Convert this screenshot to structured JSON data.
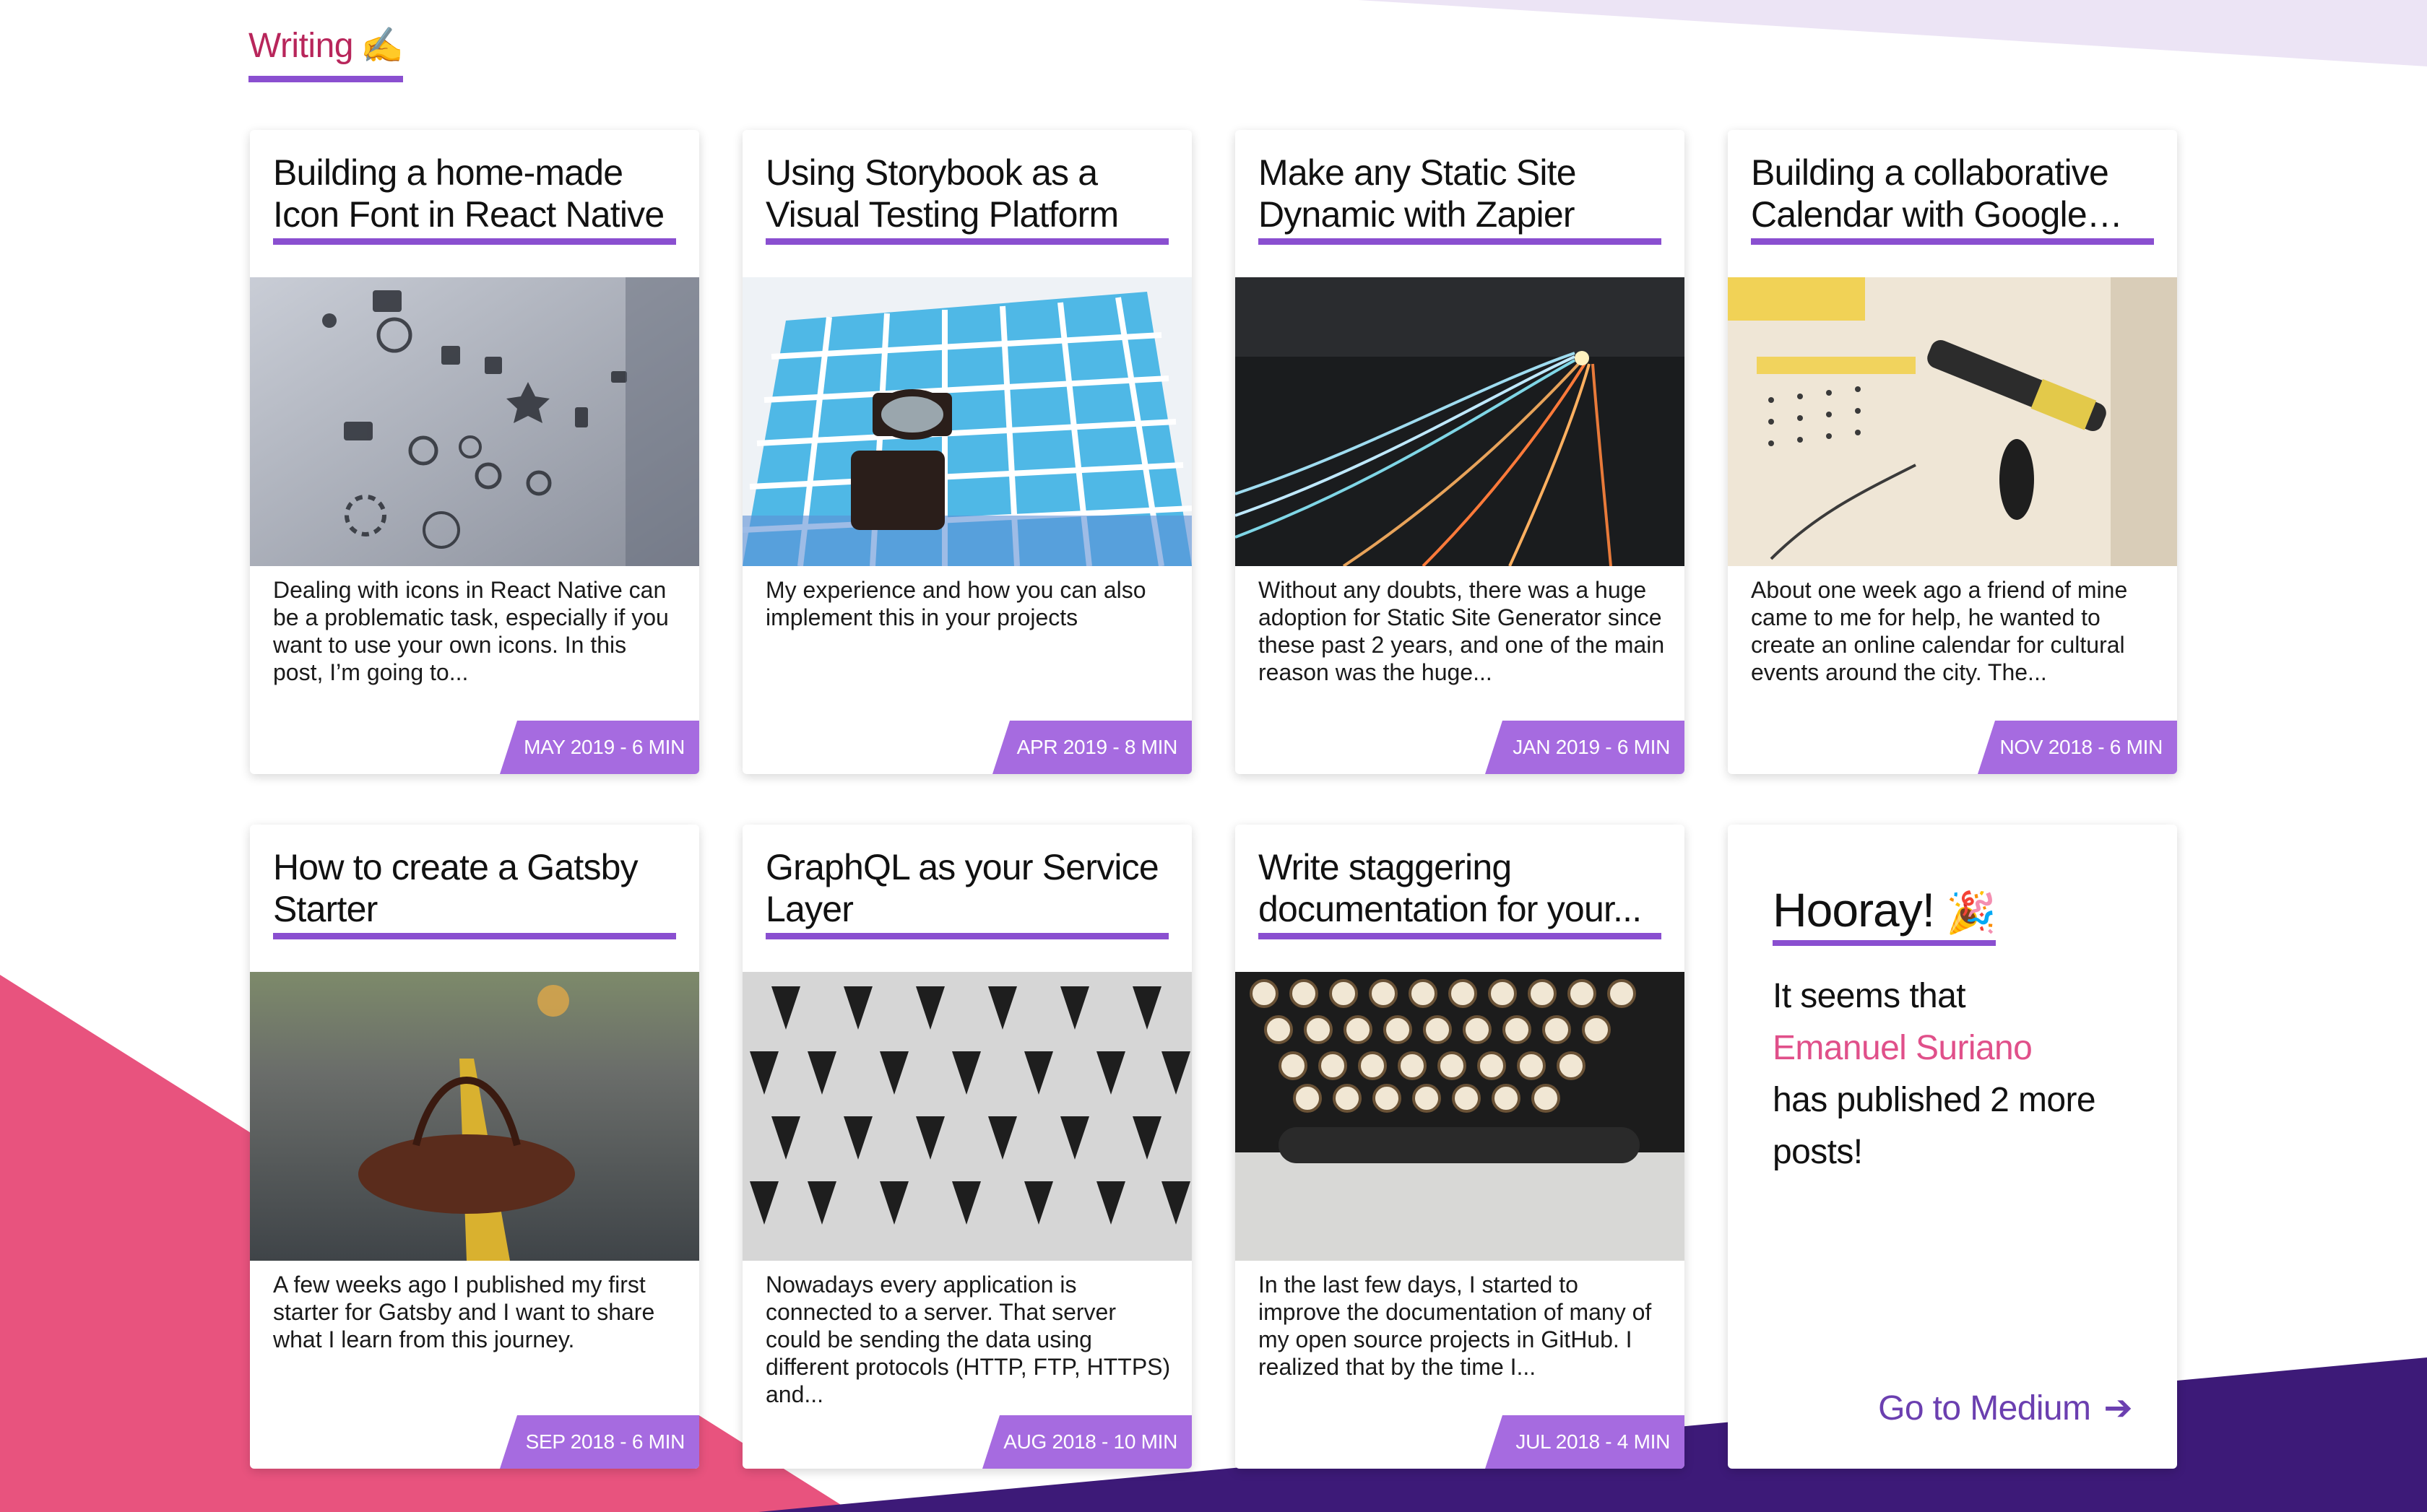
{
  "colors": {
    "accent_purple": "#8a4fd0",
    "badge_purple": "#a66be0",
    "title_magenta": "#b8265b",
    "link_pink": "#e0508a",
    "medium_purple": "#6b3fb0",
    "bg_pink": "#e8537e",
    "bg_deep_purple": "#3d1a78",
    "bg_lavender": "#ece4f5"
  },
  "section": {
    "title": "Writing",
    "emoji": "✍️"
  },
  "posts": [
    {
      "title": "Building a home-made Icon Font in React Native",
      "excerpt": "Dealing with icons in React Native can be a problematic task, especially if you want to use your own icons. In this post, I’m going to...",
      "meta": "MAY 2019 - 6 MIN",
      "image": "icons-photo"
    },
    {
      "title": "Using Storybook as a Visual Testing Platform",
      "excerpt": "My experience and how you can also implement this in your projects",
      "meta": "APR 2019 - 8 MIN",
      "image": "color-swatch-loupe-photo"
    },
    {
      "title": "Make any Static Site Dynamic with Zapier",
      "excerpt": "Without any doubts, there was a huge adoption for Static Site Generator since these past 2 years, and one of the main reason was the huge...",
      "meta": "JAN 2019 - 6 MIN",
      "image": "highway-lights-photo"
    },
    {
      "title": "Building a collaborative Calendar with Google an...",
      "excerpt": "About one week ago a friend of mine came to me for help, he wanted to create an online calendar for cultural events around the city. The...",
      "meta": "NOV 2018 - 6 MIN",
      "image": "calendar-marker-photo"
    },
    {
      "title": "How to create a Gatsby Starter",
      "excerpt": "A few weeks ago I published my first starter for Gatsby and I want to share what I learn from this journey.",
      "meta": "SEP 2018 - 6 MIN",
      "image": "bag-on-road-photo"
    },
    {
      "title": "GraphQL as your Service Layer",
      "excerpt": "Nowadays every application is connected to a server. That server could be sending the data using different protocols (HTTP, FTP, HTTPS) and...",
      "meta": "AUG 2018 - 10 MIN",
      "image": "building-facade-photo"
    },
    {
      "title": "Write staggering documentation for your...",
      "excerpt": "In the last few days, I started to improve the documentation of many of my open source projects in GitHub. I realized that by the time I...",
      "meta": "JUL 2018 - 4 MIN",
      "image": "typewriter-photo"
    }
  ],
  "hooray": {
    "title": "Hooray!",
    "emoji": "🎉",
    "line1": "It seems that",
    "author": "Emanuel Suriano",
    "line2": "has published 2 more posts!",
    "link_label": "Go to Medium",
    "link_icon": "arrow-right-icon"
  }
}
